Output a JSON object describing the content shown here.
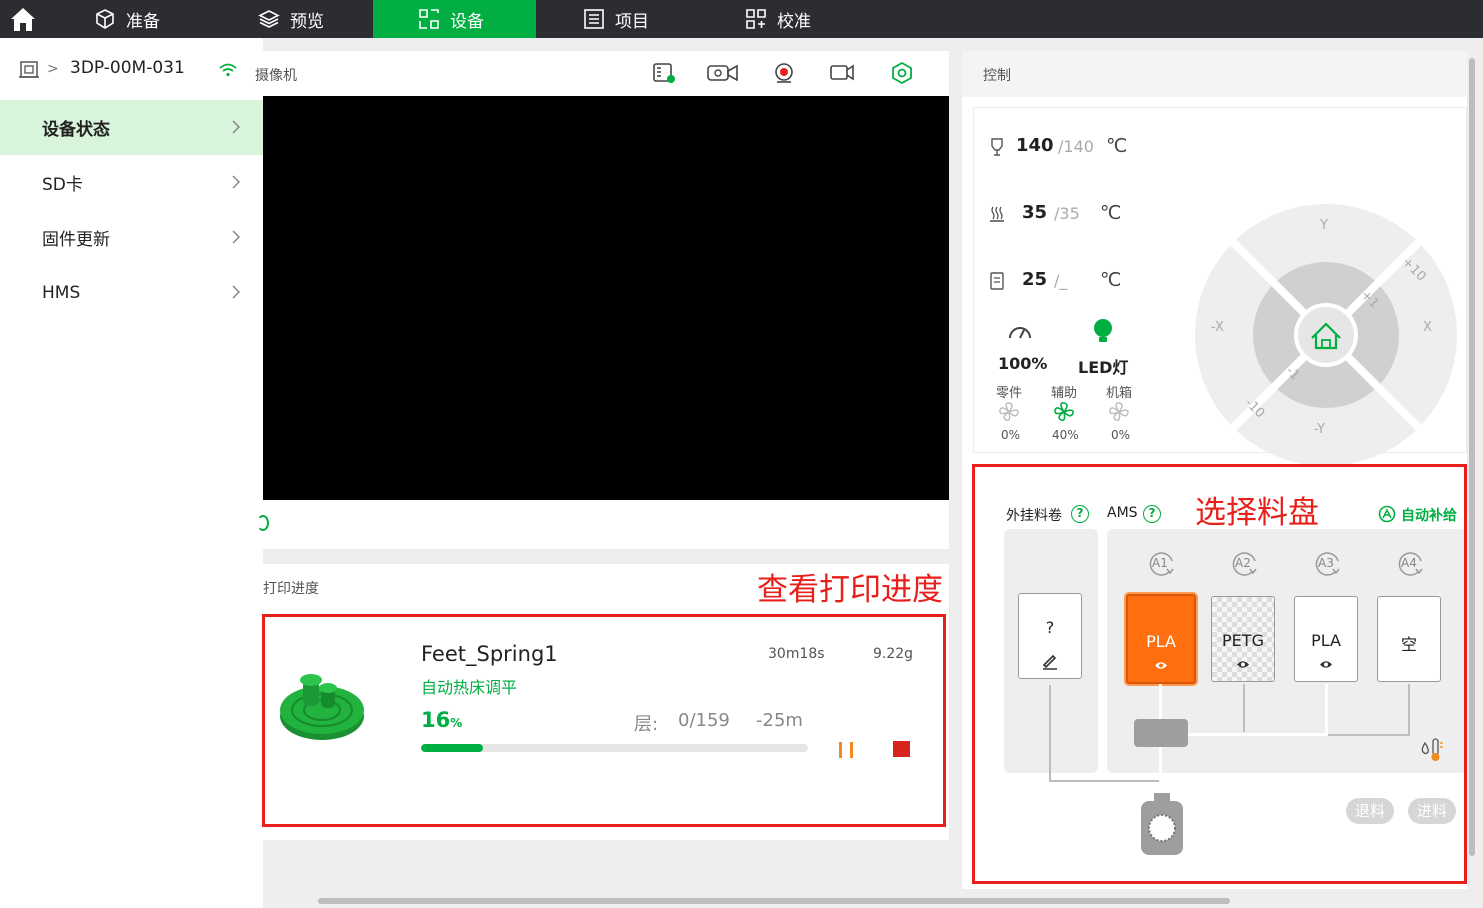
{
  "nav": {
    "home_icon": "home-icon",
    "tabs": [
      {
        "label": "准备",
        "icon": "cube-icon"
      },
      {
        "label": "预览",
        "icon": "layers-icon"
      },
      {
        "label": "设备",
        "icon": "device-icon",
        "active": true
      },
      {
        "label": "项目",
        "icon": "list-icon"
      },
      {
        "label": "校准",
        "icon": "calibrate-icon"
      }
    ]
  },
  "sidebar": {
    "device_name": "3DP-00M-031",
    "items": [
      {
        "label": "设备状态",
        "active": true
      },
      {
        "label": "SD卡"
      },
      {
        "label": "固件更新"
      },
      {
        "label": "HMS"
      }
    ]
  },
  "camera": {
    "title": "摄像机",
    "tools": [
      "sd-card-icon",
      "timelapse-icon",
      "record-icon",
      "video-icon",
      "settings-icon"
    ]
  },
  "progress": {
    "title": "打印进度",
    "annotation": "查看打印进度",
    "job_name": "Feet_Spring1",
    "stage": "自动热床调平",
    "time": "30m18s",
    "weight": "9.22g",
    "percent": "16",
    "percent_unit": "%",
    "percent_value": 16,
    "layer_label": "层:",
    "layer": "0/159",
    "remaining": "-25m"
  },
  "control": {
    "title": "控制",
    "nozzle": {
      "current": "140",
      "target": "/140",
      "unit": "℃"
    },
    "bed": {
      "current": "35",
      "target": "/35",
      "unit": "℃"
    },
    "chamber": {
      "current": "25",
      "target": "/_",
      "unit": "℃"
    },
    "speed": "100%",
    "led": "LED灯",
    "fans": [
      {
        "label": "零件",
        "value": "0%"
      },
      {
        "label": "辅助",
        "value": "40%"
      },
      {
        "label": "机箱",
        "value": "0%"
      }
    ],
    "jog": {
      "y_pos": "Y",
      "y_neg": "-Y",
      "x_pos": "X",
      "x_neg": "-X",
      "plus10": "+10",
      "plus1": "+1",
      "minus1": "-1",
      "minus10": "-10"
    }
  },
  "ams": {
    "annotation": "选择料盘",
    "external_label": "外挂料卷",
    "ams_label": "AMS",
    "auto_refill": "自动补给",
    "external_slot": "?",
    "slots": [
      {
        "tag": "A1",
        "material": "PLA",
        "color": "#ff6f0f"
      },
      {
        "tag": "A2",
        "material": "PETG"
      },
      {
        "tag": "A3",
        "material": "PLA"
      },
      {
        "tag": "A4",
        "material": "空"
      }
    ],
    "unload": "退料",
    "load": "进料"
  }
}
